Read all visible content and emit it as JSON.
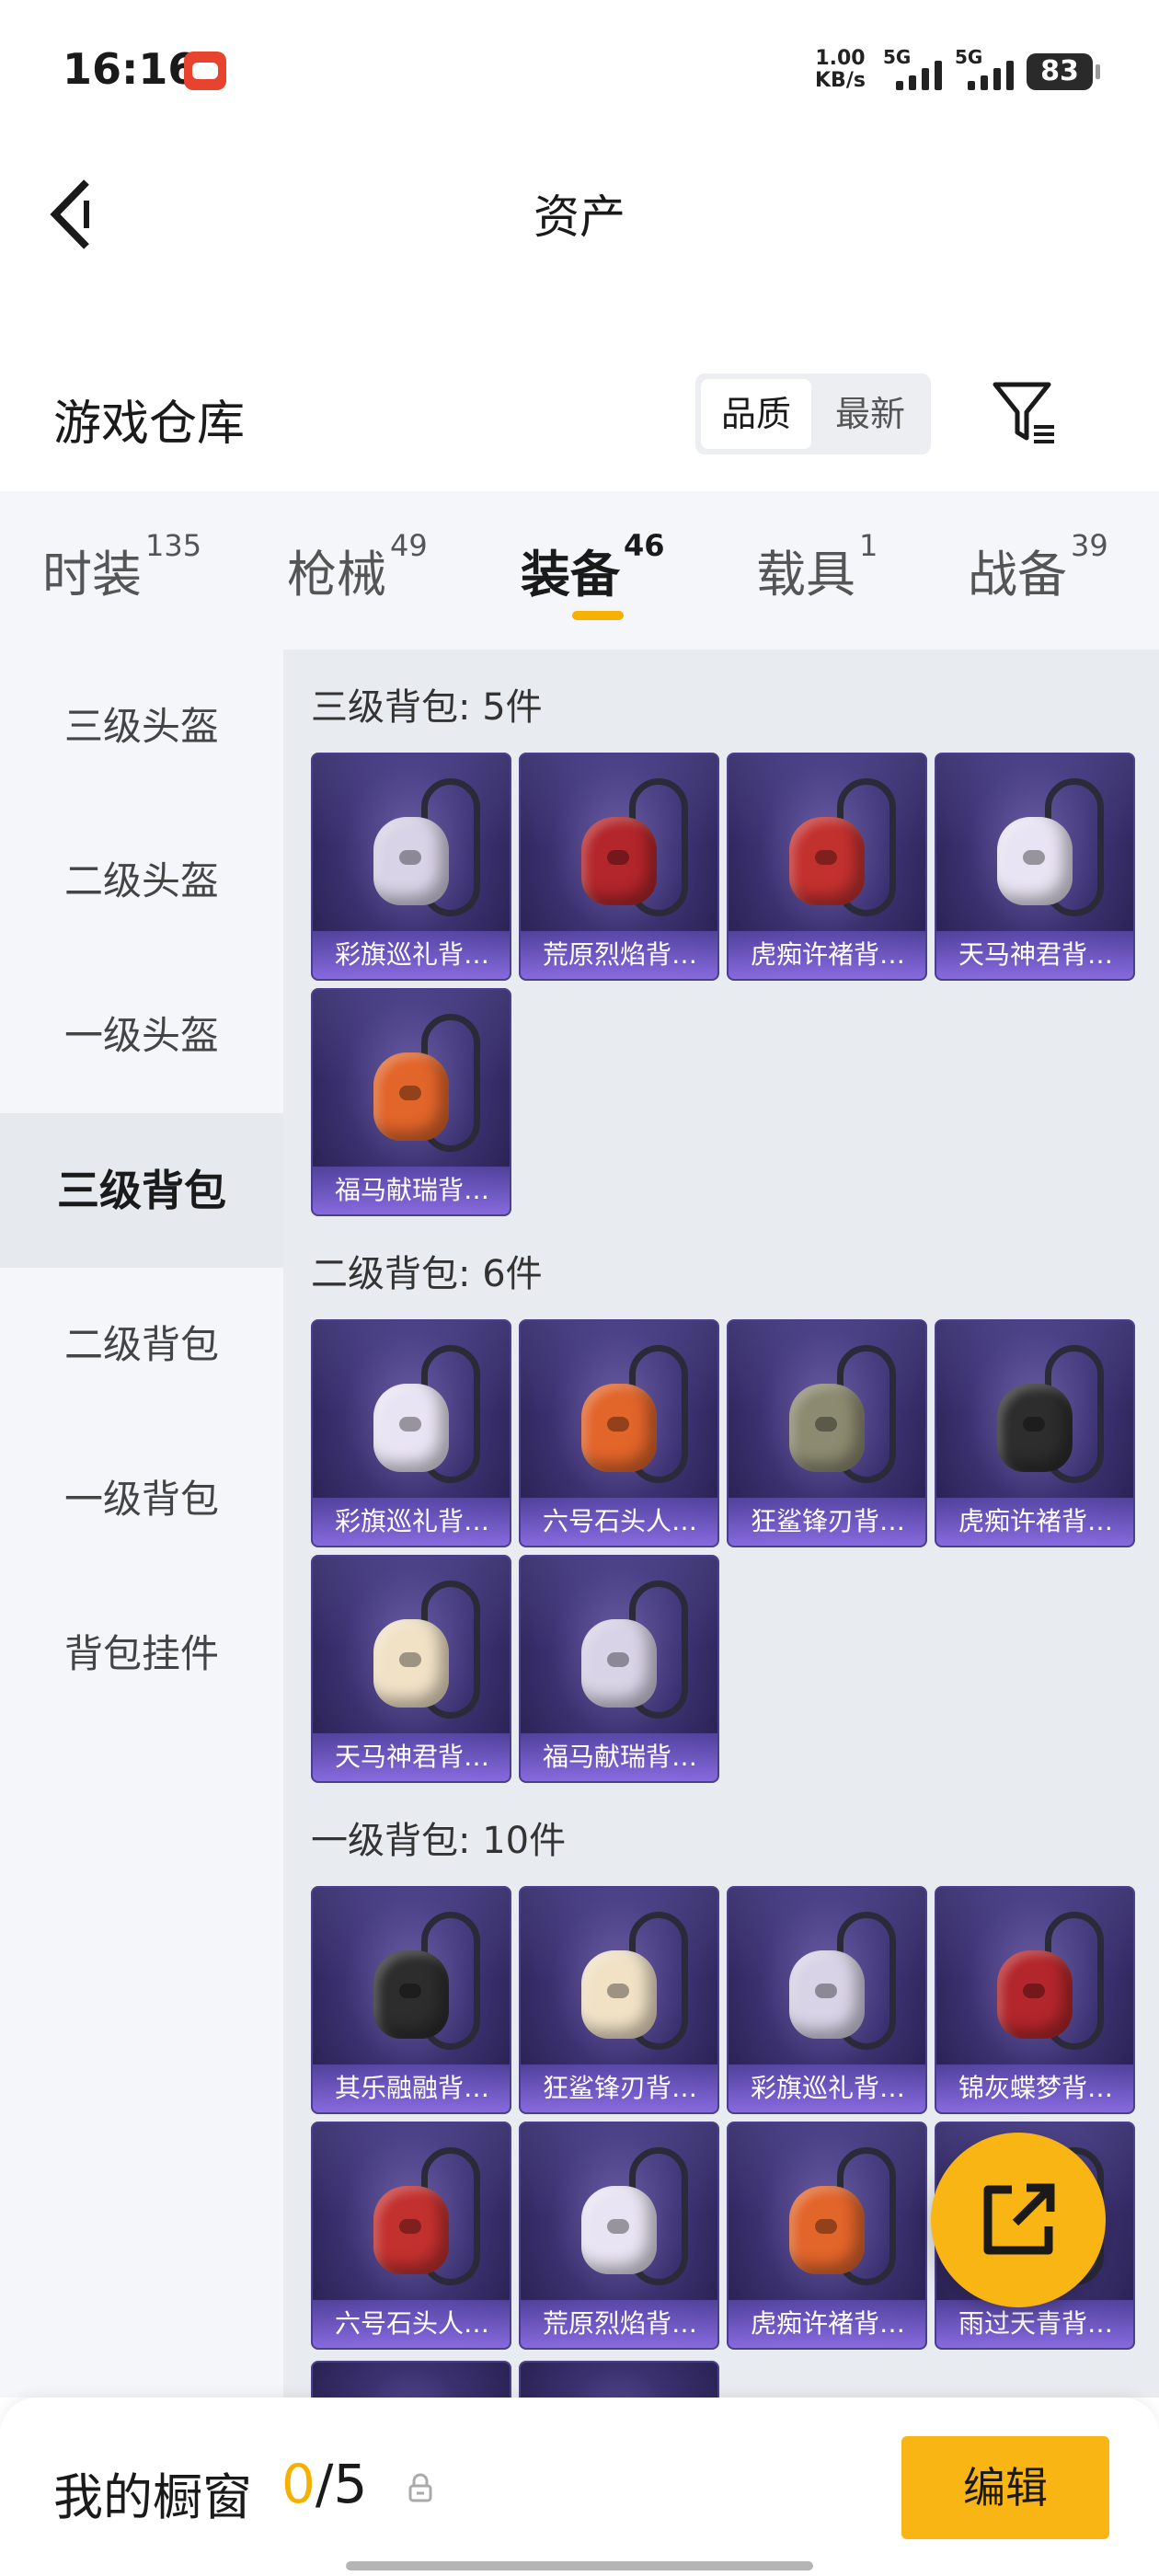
{
  "status_bar": {
    "time": "16:16",
    "net_speed_value": "1.00",
    "net_speed_unit": "KB/s",
    "signal1": "5G",
    "signal2": "5G",
    "battery": "83"
  },
  "header": {
    "title": "资产"
  },
  "warehouse": {
    "title": "游戏仓库",
    "sort_options": [
      "品质",
      "最新"
    ],
    "active_sort": "品质"
  },
  "tabs": [
    {
      "label": "时装",
      "count": "135"
    },
    {
      "label": "枪械",
      "count": "49"
    },
    {
      "label": "装备",
      "count": "46"
    },
    {
      "label": "载具",
      "count": "1"
    },
    {
      "label": "战备",
      "count": "39"
    }
  ],
  "active_tab": "装备",
  "sidenav": [
    "三级头盔",
    "二级头盔",
    "一级头盔",
    "三级背包",
    "二级背包",
    "一级背包",
    "背包挂件"
  ],
  "active_side": "三级背包",
  "sections": [
    {
      "title": "三级背包: 5件",
      "items": [
        "彩旗巡礼背…",
        "荒原烈焰背…",
        "虎痴许褚背…",
        "天马神君背…",
        "福马献瑞背…"
      ]
    },
    {
      "title": "二级背包: 6件",
      "items": [
        "彩旗巡礼背…",
        "六号石头人…",
        "狂鲨锋刃背…",
        "虎痴许褚背…",
        "天马神君背…",
        "福马献瑞背…"
      ]
    },
    {
      "title": "一级背包: 10件",
      "items": [
        "其乐融融背…",
        "狂鲨锋刃背…",
        "彩旗巡礼背…",
        "锦灰蝶梦背…",
        "六号石头人…",
        "荒原烈焰背…",
        "虎痴许褚背…",
        "雨过天青背…"
      ]
    }
  ],
  "showcase": {
    "title": "我的橱窗",
    "used": "0",
    "total": "/5",
    "edit_label": "编辑"
  },
  "icons": {
    "back": "chevron-left-icon",
    "filter": "filter-icon",
    "share": "share-external-icon",
    "lock": "lock-icon"
  }
}
